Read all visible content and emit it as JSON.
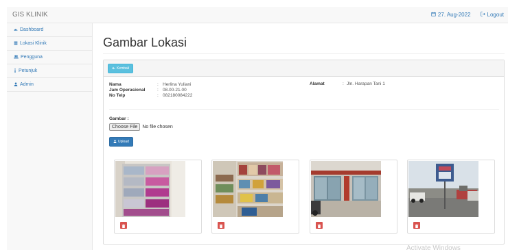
{
  "navbar": {
    "brand": "GIS KLINIK",
    "date": "27. Aug-2022",
    "logout": "Logout",
    "calendar_icon": "calendar-icon",
    "logout_icon": "sign-out-icon"
  },
  "sidebar": {
    "items": [
      {
        "label": "Dashboard",
        "icon": "dashboard-icon"
      },
      {
        "label": "Lokasi Klinik",
        "icon": "list-icon"
      },
      {
        "label": "Pengguna",
        "icon": "users-icon"
      },
      {
        "label": "Petunjuk",
        "icon": "info-icon"
      },
      {
        "label": "Admin",
        "icon": "user-icon"
      }
    ]
  },
  "main": {
    "title": "Gambar Lokasi",
    "back_button": "Kembali",
    "info": {
      "nama_label": "Nama",
      "nama_value": "Herlina Yuliani",
      "jam_label": "Jam Operasional",
      "jam_value": "08.00-21.00",
      "telp_label": "No Telp",
      "telp_value": "082180084222",
      "alamat_label": "Alamat",
      "alamat_value": "Jln. Harapan Tani 1",
      "colon": ":"
    },
    "gambar_label": "Gambar :",
    "file_button": "Choose File",
    "file_status": "No file chosen",
    "upload_button": "Upload"
  },
  "thumbnails": [
    {
      "name": "photo-shop-shelves",
      "delete_icon": "trash-icon"
    },
    {
      "name": "photo-store-display",
      "delete_icon": "trash-icon"
    },
    {
      "name": "photo-storefront",
      "delete_icon": "trash-icon"
    },
    {
      "name": "photo-street-sign",
      "delete_icon": "trash-icon"
    }
  ],
  "colors": {
    "primary": "#337ab7",
    "info": "#5bc0de",
    "danger": "#d9534f"
  },
  "watermark": "Activate Windows"
}
